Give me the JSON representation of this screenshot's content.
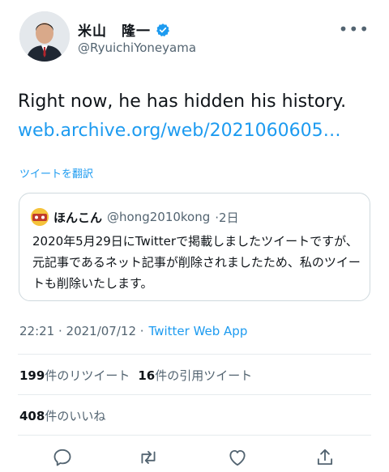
{
  "author": {
    "name": "米山　隆一",
    "handle": "@RyuichiYoneyama",
    "verified": true
  },
  "tweet": {
    "text": "Right now, he has hidden his history.",
    "link_text": "web.archive.org/web/2021060605…",
    "translate_label": "ツイートを翻訳"
  },
  "quote": {
    "name": "ほんこん",
    "handle": "@hong2010kong",
    "time": "·2日",
    "text": "2020年5月29日にTwitterで掲載しましたツイートですが、元記事であるネット記事が削除されましたため、私のツイートも削除いたします。"
  },
  "meta": {
    "time": "22:21 · 2021/07/12 ·",
    "app": "Twitter Web App"
  },
  "stats": {
    "retweets": "199",
    "retweets_label": "件のリツイート",
    "quotes": "16",
    "quotes_label": "件の引用ツイート",
    "likes": "408",
    "likes_label": "件のいいね"
  },
  "icons": {
    "more": "more-icon",
    "verified": "verified-badge-icon",
    "reply": "reply-icon",
    "retweet": "retweet-icon",
    "like": "like-icon",
    "share": "share-icon"
  },
  "colors": {
    "accent": "#1d9bf0",
    "muted": "#536471",
    "border": "#cfd9de"
  }
}
